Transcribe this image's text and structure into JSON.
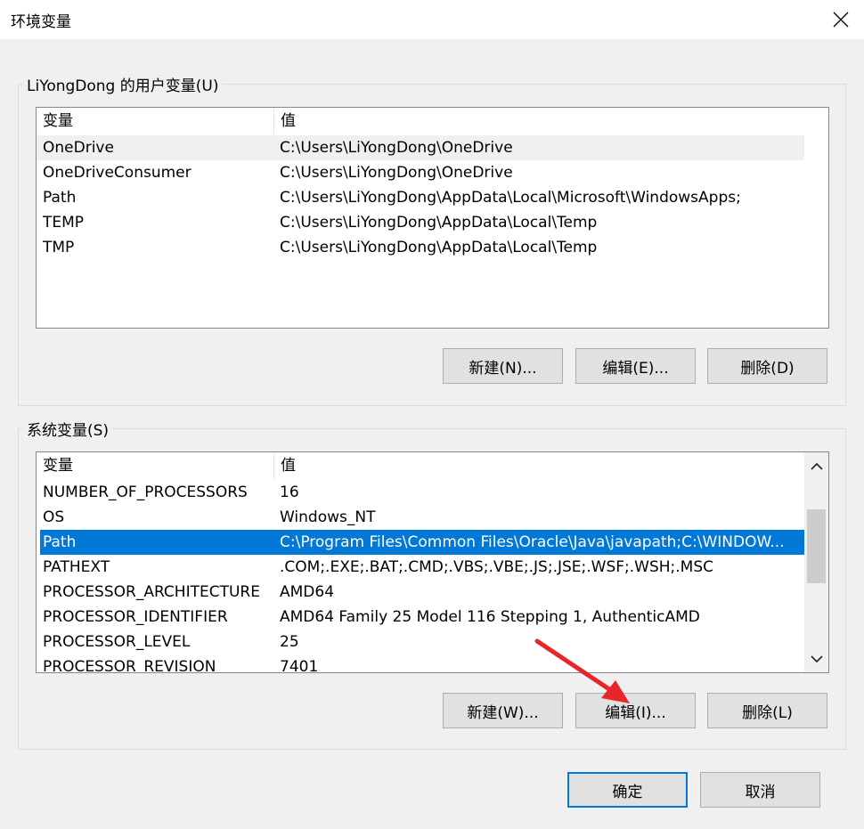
{
  "window": {
    "title": "环境变量"
  },
  "user_vars": {
    "group_label": "LiYongDong 的用户变量(U)",
    "col_var": "变量",
    "col_val": "值",
    "rows": [
      {
        "name": "OneDrive",
        "value": "C:\\Users\\LiYongDong\\OneDrive"
      },
      {
        "name": "OneDriveConsumer",
        "value": "C:\\Users\\LiYongDong\\OneDrive"
      },
      {
        "name": "Path",
        "value": "C:\\Users\\LiYongDong\\AppData\\Local\\Microsoft\\WindowsApps;"
      },
      {
        "name": "TEMP",
        "value": "C:\\Users\\LiYongDong\\AppData\\Local\\Temp"
      },
      {
        "name": "TMP",
        "value": "C:\\Users\\LiYongDong\\AppData\\Local\\Temp"
      }
    ],
    "btn_new": "新建(N)...",
    "btn_edit": "编辑(E)...",
    "btn_delete": "删除(D)"
  },
  "system_vars": {
    "group_label": "系统变量(S)",
    "col_var": "变量",
    "col_val": "值",
    "rows": [
      {
        "name": "NUMBER_OF_PROCESSORS",
        "value": "16"
      },
      {
        "name": "OS",
        "value": "Windows_NT"
      },
      {
        "name": "Path",
        "value": "C:\\Program Files\\Common Files\\Oracle\\Java\\javapath;C:\\WINDOW..."
      },
      {
        "name": "PATHEXT",
        "value": ".COM;.EXE;.BAT;.CMD;.VBS;.VBE;.JS;.JSE;.WSF;.WSH;.MSC"
      },
      {
        "name": "PROCESSOR_ARCHITECTURE",
        "value": "AMD64"
      },
      {
        "name": "PROCESSOR_IDENTIFIER",
        "value": "AMD64 Family 25 Model 116 Stepping 1, AuthenticAMD"
      },
      {
        "name": "PROCESSOR_LEVEL",
        "value": "25"
      },
      {
        "name": "PROCESSOR_REVISION",
        "value": "7401"
      }
    ],
    "btn_new": "新建(W)...",
    "btn_edit": "编辑(I)...",
    "btn_delete": "删除(L)"
  },
  "footer": {
    "ok": "确定",
    "cancel": "取消"
  },
  "colors": {
    "selection_blue": "#0078d7",
    "annotation_arrow": "#e8262a"
  },
  "icons": {
    "close": "close-icon",
    "scroll_up": "chevron-up-icon",
    "scroll_down": "chevron-down-icon",
    "arrow": "red-arrow-annotation"
  }
}
